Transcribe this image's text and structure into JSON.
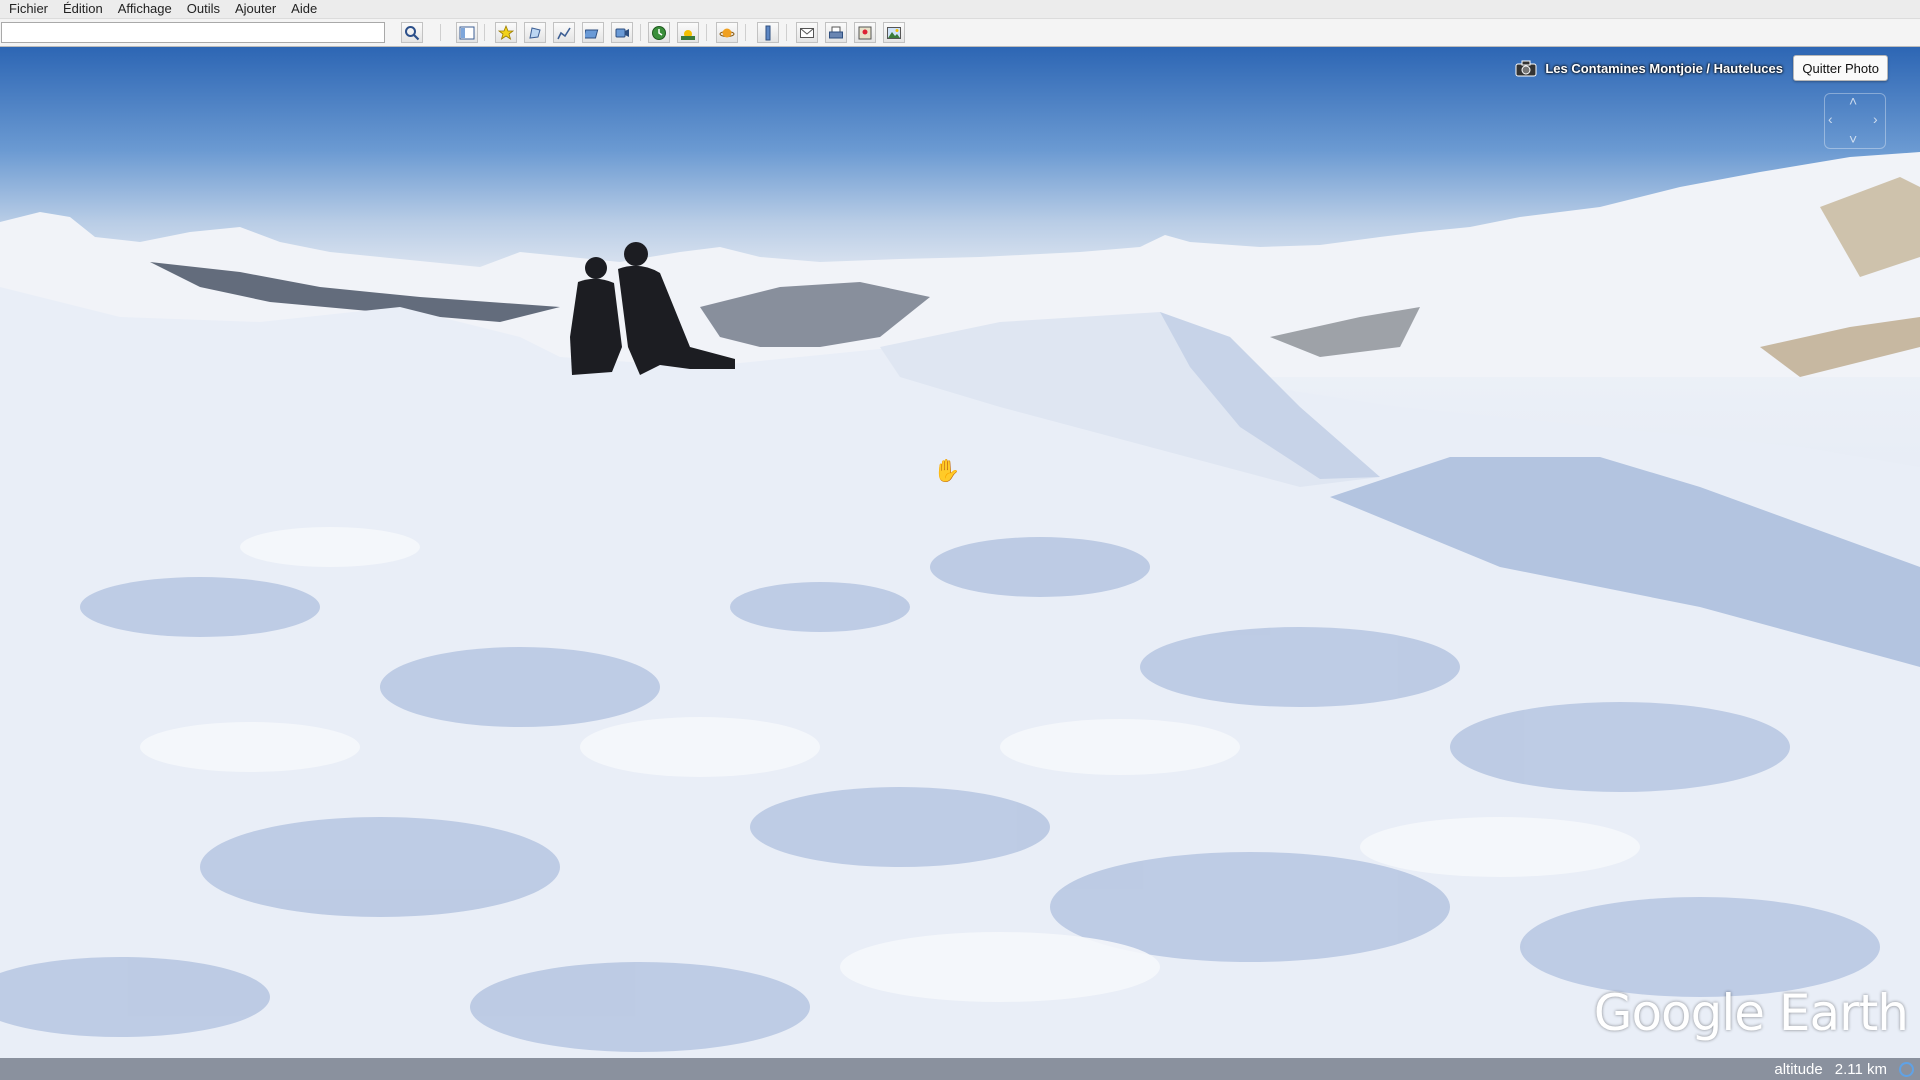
{
  "menu": {
    "items": [
      "Fichier",
      "Édition",
      "Affichage",
      "Outils",
      "Ajouter",
      "Aide"
    ]
  },
  "toolbar": {
    "search_value": "",
    "search_icon": "search-icon",
    "buttons": [
      {
        "name": "sidebar-toggle-icon"
      },
      {
        "name": "placemark-icon"
      },
      {
        "name": "polygon-icon"
      },
      {
        "name": "path-icon"
      },
      {
        "name": "image-overlay-icon"
      },
      {
        "name": "record-tour-icon"
      },
      {
        "name": "historical-imagery-icon"
      },
      {
        "name": "sunlight-icon"
      },
      {
        "name": "planets-icon"
      },
      {
        "name": "ruler-icon"
      },
      {
        "name": "email-icon"
      },
      {
        "name": "print-icon"
      },
      {
        "name": "view-in-maps-icon"
      },
      {
        "name": "save-image-icon"
      }
    ]
  },
  "viewer": {
    "photo_location": "Les Contamines Montjoie / Hauteluces",
    "exit_button": "Quitter Photo",
    "logo": "Google Earth",
    "status": {
      "label": "altitude",
      "value": "2.11 km"
    }
  },
  "colors": {
    "sky_top": "#2d66b4",
    "snow": "#e8edf6",
    "snow_shadow": "#b9c9e3",
    "status_indicator": "#5fa2e6"
  }
}
